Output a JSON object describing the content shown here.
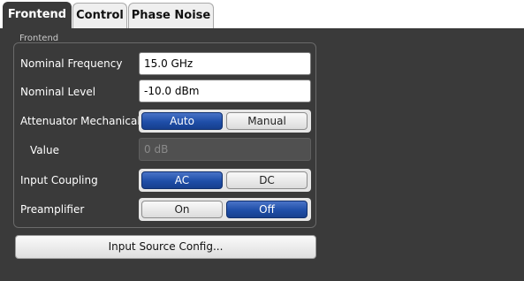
{
  "tabs": [
    {
      "label": "Frontend",
      "active": true
    },
    {
      "label": "Control",
      "active": false
    },
    {
      "label": "Phase Noise",
      "active": false
    }
  ],
  "group": {
    "title": "Frontend"
  },
  "nominal_frequency": {
    "label": "Nominal Frequency",
    "value": "15.0 GHz"
  },
  "nominal_level": {
    "label": "Nominal Level",
    "value": "-10.0 dBm"
  },
  "attenuator_mechanical": {
    "label": "Attenuator Mechanical",
    "options": [
      "Auto",
      "Manual"
    ],
    "selected": "Auto"
  },
  "attenuator_value": {
    "label": "Value",
    "value": "0 dB",
    "enabled": false
  },
  "input_coupling": {
    "label": "Input Coupling",
    "options": [
      "AC",
      "DC"
    ],
    "selected": "AC"
  },
  "preamplifier": {
    "label": "Preamplifier",
    "options": [
      "On",
      "Off"
    ],
    "selected": "Off"
  },
  "input_source_button": {
    "label": "Input Source Config..."
  },
  "colors": {
    "panel_background": "#3a3a3a",
    "tabbar_background": "#ffffff",
    "toggle_selected": "#1f4ea8",
    "toggle_unselected": "#e6e6e6"
  }
}
